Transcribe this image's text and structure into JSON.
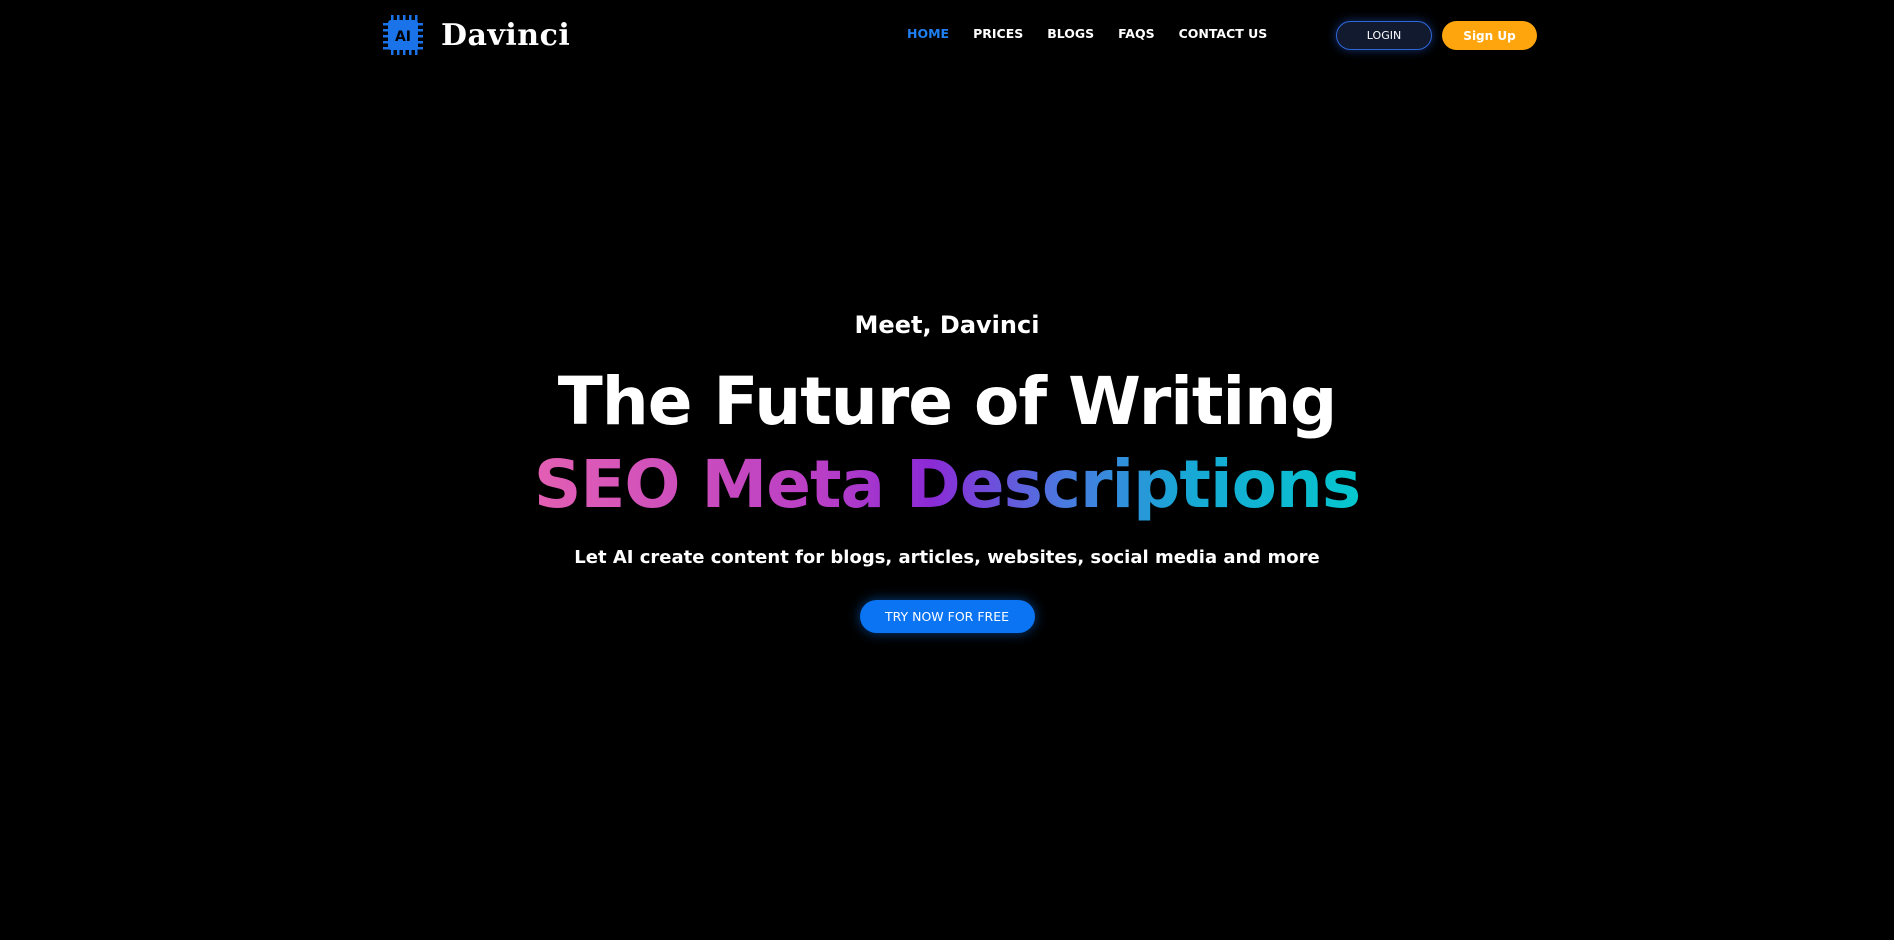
{
  "brand": {
    "name": "Davinci",
    "chip_text": "AI",
    "accent_color": "#0a74f2",
    "chip_icon": "cpu-chip-icon"
  },
  "nav": {
    "items": [
      {
        "label": "HOME",
        "active": true
      },
      {
        "label": "PRICES",
        "active": false
      },
      {
        "label": "BLOGS",
        "active": false
      },
      {
        "label": "FAQS",
        "active": false
      },
      {
        "label": "CONTACT US",
        "active": false
      }
    ],
    "active_color": "#1f7ef0",
    "login_label": "LOGIN",
    "signup_label": "Sign Up",
    "signup_color": "#fea50d"
  },
  "hero": {
    "eyebrow": "Meet, Davinci",
    "headline": "The Future of Writing",
    "gradient_line": "SEO Meta Descriptions",
    "subtext": "Let AI create content for blogs, articles, websites, social media and more",
    "cta_label": "TRY NOW FOR FREE",
    "gradient_colors": [
      "#e35fb3",
      "#8c2ad6",
      "#05c7ce"
    ]
  }
}
